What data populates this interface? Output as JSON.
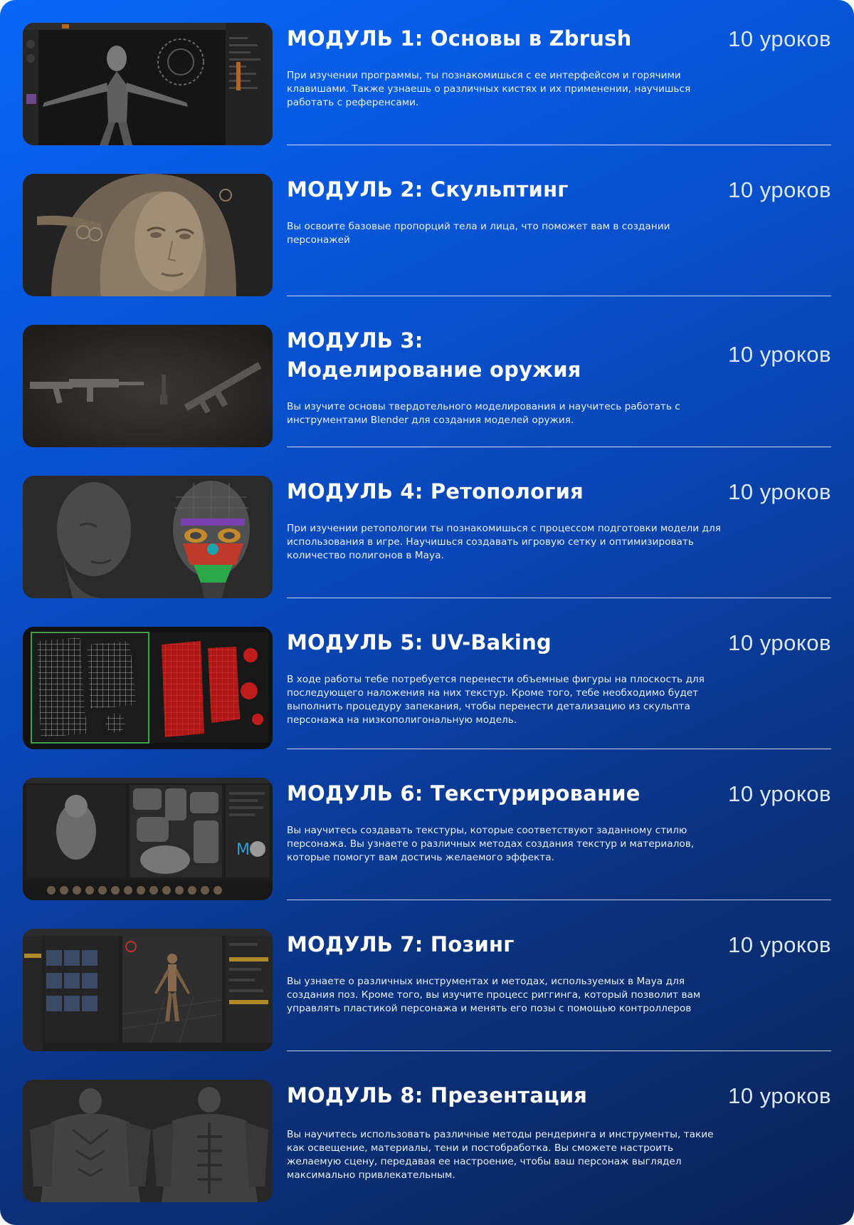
{
  "colors": {
    "gradient_top": "#0866f6",
    "gradient_bottom": "#0a2356",
    "text": "#ffffff",
    "divider": "#ffffff"
  },
  "modules": [
    {
      "title_lines": [
        "МОДУЛЬ 1: Основы в Zbrush"
      ],
      "lessons": "10 уроков",
      "description": "При изучении программы, ты познакомишься с ее интерфейсом и горячими клавишами. Также узнаешь о различных кистях и их применении, научишься работать с референсами.",
      "image": "zbrush-interface-sculpt-thumbnail"
    },
    {
      "title_lines": [
        "МОДУЛЬ 2: Скульптинг"
      ],
      "lessons": "10 уроков",
      "description": "Вы освоите базовые пропорций тела и лица, что поможет вам в создании персонажей",
      "image": "sculpted-female-face-thumbnail"
    },
    {
      "title_lines": [
        "МОДУЛЬ 3:",
        "Моделирование оружия"
      ],
      "lessons": "10 уроков",
      "description": "Вы изучите основы твердотельного моделирования и научитесь работать с инструментами Blender для создания моделей оружия.",
      "image": "rifle-models-thumbnail"
    },
    {
      "title_lines": [
        "МОДУЛЬ 4: Ретопология"
      ],
      "lessons": "10 уроков",
      "description": "При изучении ретопологии ты познакомишься с процессом подготовки модели для использования в игре. Научишься создавать игровую сетку и оптимизировать количество полигонов в Maya.",
      "image": "retopology-heads-thumbnail"
    },
    {
      "title_lines": [
        "МОДУЛЬ 5: UV-Baking"
      ],
      "lessons": "10 уроков",
      "description": "В ходе работы тебе потребуется перенести объемные фигуры на плоскость для последующего наложения на них текстур. Кроме того, тебе необходимо будет выполнить процедуру запекания, чтобы перенести детализацию из скульпта персонажа на низкополигональную модель.",
      "image": "uv-layout-thumbnail"
    },
    {
      "title_lines": [
        "МОДУЛЬ 6: Текстурирование"
      ],
      "lessons": "10 уроков",
      "description": "Вы научитесь создавать текстуры, которые соответствуют заданному стилю персонажа. Вы узнаете о различных методах создания текстур и материалов, которые помогут вам достичь желаемого эффекта.",
      "image": "texturing-interface-thumbnail"
    },
    {
      "title_lines": [
        "МОДУЛЬ 7: Позинг"
      ],
      "lessons": "10 уроков",
      "description": "Вы узнаете о различных инструментах и методах, используемых в Maya для создания поз. Кроме того, вы изучите процесс риггинга, который позволит вам управлять пластикой персонажа и менять его позы с помощью контроллеров",
      "image": "maya-posing-thumbnail"
    },
    {
      "title_lines": [
        "МОДУЛЬ 8: Презентация"
      ],
      "lessons": "10 уроков",
      "description": "Вы научитесь использовать различные методы рендеринга и инструменты, такие как освещение, материалы, тени и постобработка. Вы сможете настроить желаемую сцену, передавая ее настроение, чтобы ваш персонаж выглядел максимально привлекательным.",
      "image": "armored-character-render-thumbnail"
    }
  ]
}
